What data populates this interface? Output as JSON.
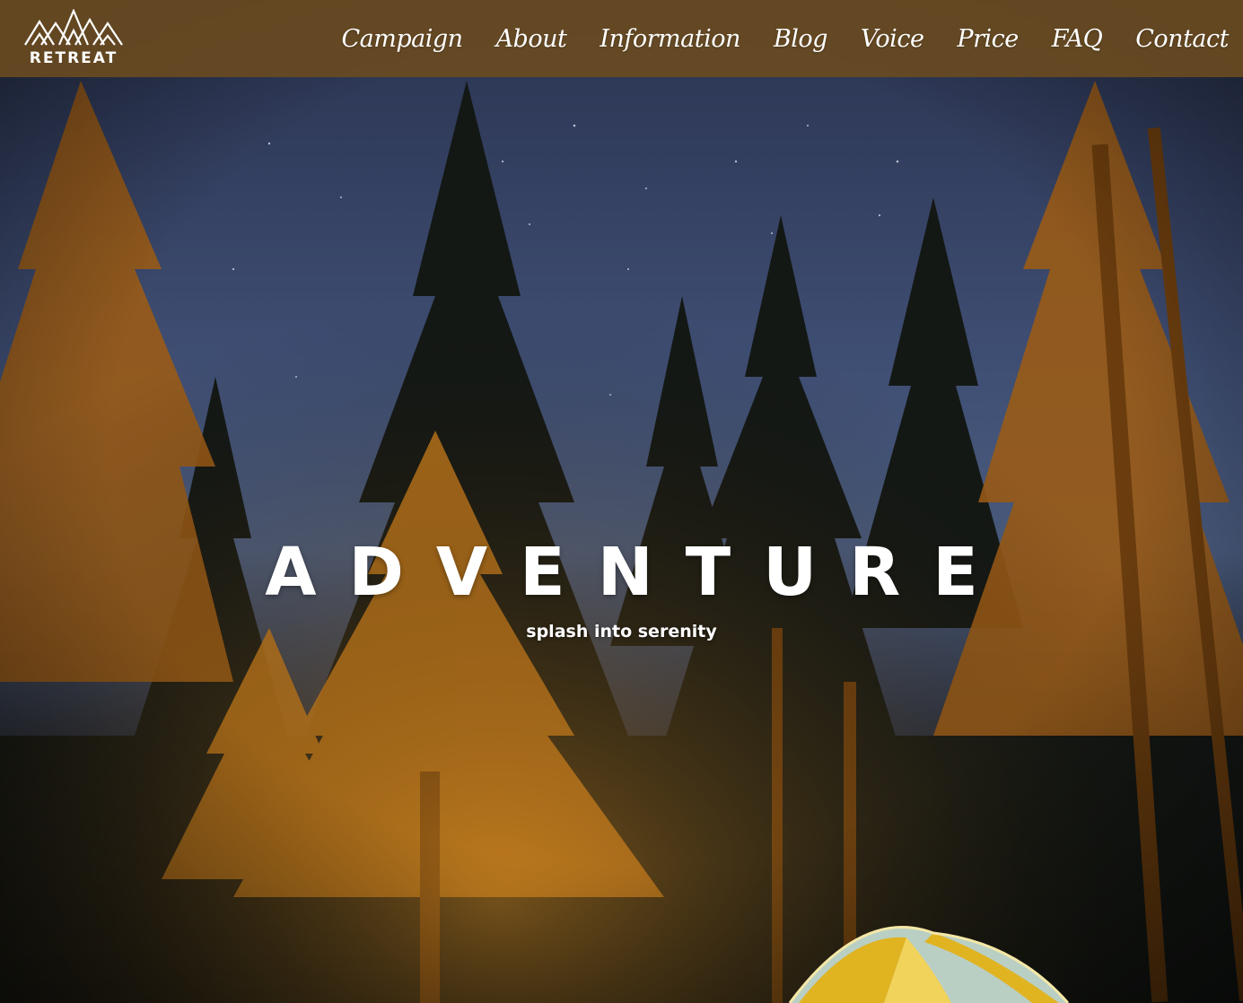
{
  "brand": {
    "name": "RETREAT",
    "logo_icon": "mountains-icon"
  },
  "nav": {
    "items": [
      {
        "label": "Campaign"
      },
      {
        "label": "About"
      },
      {
        "label": "Information"
      },
      {
        "label": "Blog"
      },
      {
        "label": "Voice"
      },
      {
        "label": "Price"
      },
      {
        "label": "FAQ"
      },
      {
        "label": "Contact"
      }
    ]
  },
  "hero": {
    "headline": "ADVENTURE",
    "tagline": "splash into serenity",
    "image_subject": "starry night sky over pine forest with glowing tent"
  },
  "colors": {
    "navbar": "#684a20",
    "sky": "#3a4a6e",
    "tree_glow": "#c8801f",
    "text": "#ffffff"
  }
}
